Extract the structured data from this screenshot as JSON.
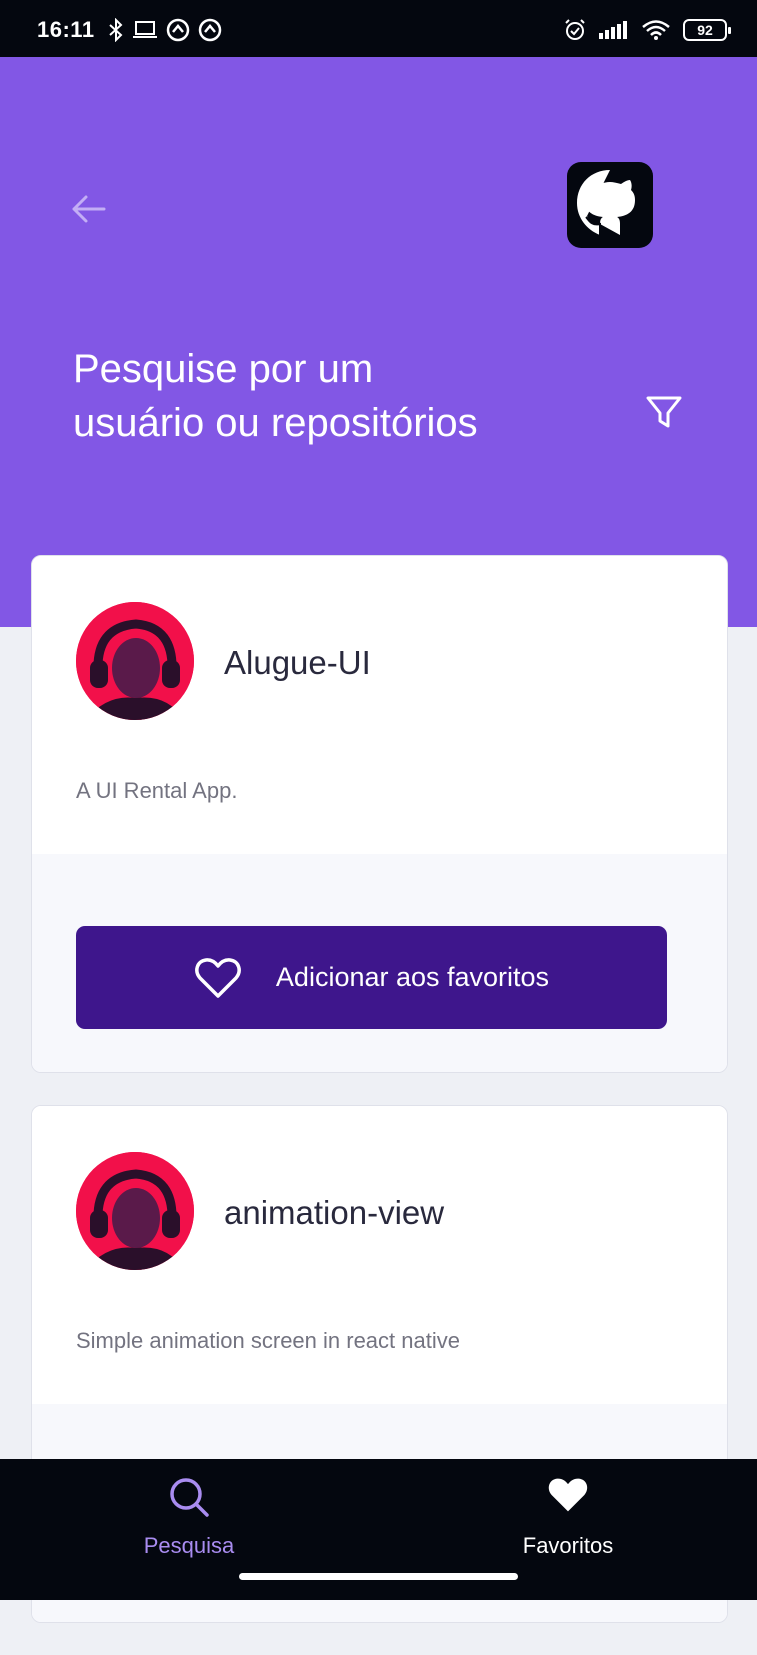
{
  "status_bar": {
    "time": "16:11",
    "battery": "92",
    "left_icons": [
      "bluetooth-icon",
      "laptop-icon",
      "app-icon",
      "app-icon"
    ],
    "right_icons": [
      "alarm-icon",
      "signal-icon",
      "wifi-icon",
      "battery-icon"
    ]
  },
  "header": {
    "title": "Pesquise por um usuário ou repositórios",
    "back_icon": "arrow-left-icon",
    "logo_icon": "github-icon",
    "filter_icon": "filter-icon",
    "background_color": "#8257e5"
  },
  "repositories": [
    {
      "name": "Alugue-UI",
      "description": "A UI Rental App.",
      "favorite_label": "Adicionar aos favoritos"
    },
    {
      "name": "animation-view",
      "description": "Simple animation screen in react native"
    }
  ],
  "tab_bar": {
    "tabs": [
      {
        "label": "Pesquisa",
        "icon": "search-icon",
        "active": true
      },
      {
        "label": "Favoritos",
        "icon": "heart-icon",
        "active": false
      }
    ]
  },
  "colors": {
    "accent": "#8257e5",
    "button": "#3e168c",
    "dark": "#04070f",
    "avatar": "#f2104a"
  }
}
